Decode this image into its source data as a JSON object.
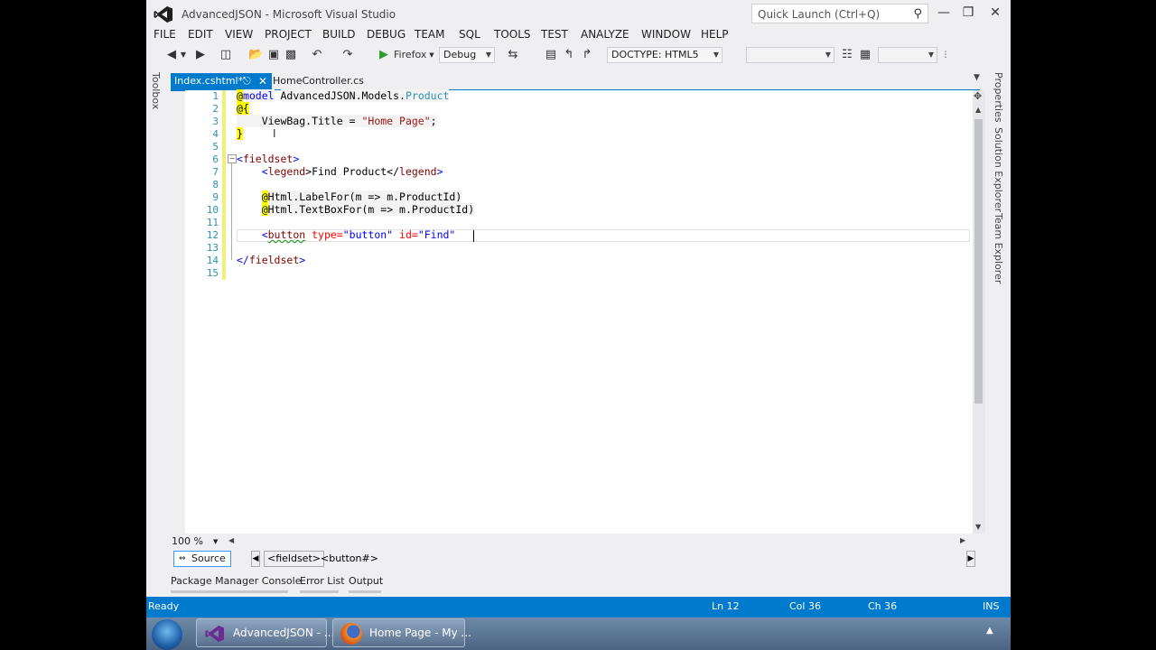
{
  "window": {
    "title": "AdvancedJSON - Microsoft Visual Studio",
    "quick_launch": "Quick Launch (Ctrl+Q)"
  },
  "menu": [
    "FILE",
    "EDIT",
    "VIEW",
    "PROJECT",
    "BUILD",
    "DEBUG",
    "TEAM",
    "SQL",
    "TOOLS",
    "TEST",
    "ANALYZE",
    "WINDOW",
    "HELP"
  ],
  "toolbar": {
    "run_target": "Firefox",
    "config": "Debug",
    "doctype": "DOCTYPE: HTML5"
  },
  "side": {
    "toolbox": "Toolbox",
    "right_tabs": [
      "Properties",
      "Solution Explorer",
      "Team Explorer"
    ]
  },
  "tabs": {
    "active": "Index.cshtml*",
    "other": "HomeController.cs"
  },
  "editor": {
    "line_numbers": [
      "1",
      "2",
      "3",
      "4",
      "5",
      "6",
      "7",
      "8",
      "9",
      "10",
      "11",
      "12",
      "13",
      "14",
      "15"
    ],
    "l1_at": "@",
    "l1_kw": "model",
    "l1_ns": "AdvancedJSON.Models.",
    "l1_type": "Product",
    "l2": "@{",
    "l3_pre": "    ViewBag.Title = ",
    "l3_str": "\"Home Page\"",
    "l3_post": ";",
    "l4": "}",
    "l6_open": "<",
    "l6_tag": "fieldset",
    "l6_close": ">",
    "l7_pre": "    <",
    "l7_tag": "legend",
    "l7_mid": ">Find Product</",
    "l7_tag2": "legend",
    "l7_end": ">",
    "l9_at": "@",
    "l9_rest": "Html.LabelFor(m => m.ProductId)",
    "l10_at": "@",
    "l10_rest": "Html.TextBoxFor(m => m.ProductId)",
    "l12_pre": "    <",
    "l12_tag": "button",
    "l12_a1": " type=",
    "l12_v1": "\"button\"",
    "l12_a2": " id=",
    "l12_v2": "\"Find\"",
    "l14_open": "</",
    "l14_tag": "fieldset",
    "l14_close": ">",
    "zoom": "100 %"
  },
  "html_nav": {
    "source": "Source",
    "crumb1": "<fieldset>",
    "crumb2": "<button#>"
  },
  "tool_tabs": [
    "Package Manager Console",
    "Error List",
    "Output"
  ],
  "status": {
    "ready": "Ready",
    "ln": "Ln 12",
    "col": "Col 36",
    "ch": "Ch 36",
    "ins": "INS"
  },
  "taskbar": {
    "vs": "AdvancedJSON - ...",
    "ff": "Home Page - My ..."
  },
  "colors": {
    "accent": "#007acc",
    "line_number": "#2b91af",
    "keyword": "#0000ff",
    "string": "#a31515",
    "tag": "#800000",
    "razor_highlight": "#ffff00"
  }
}
